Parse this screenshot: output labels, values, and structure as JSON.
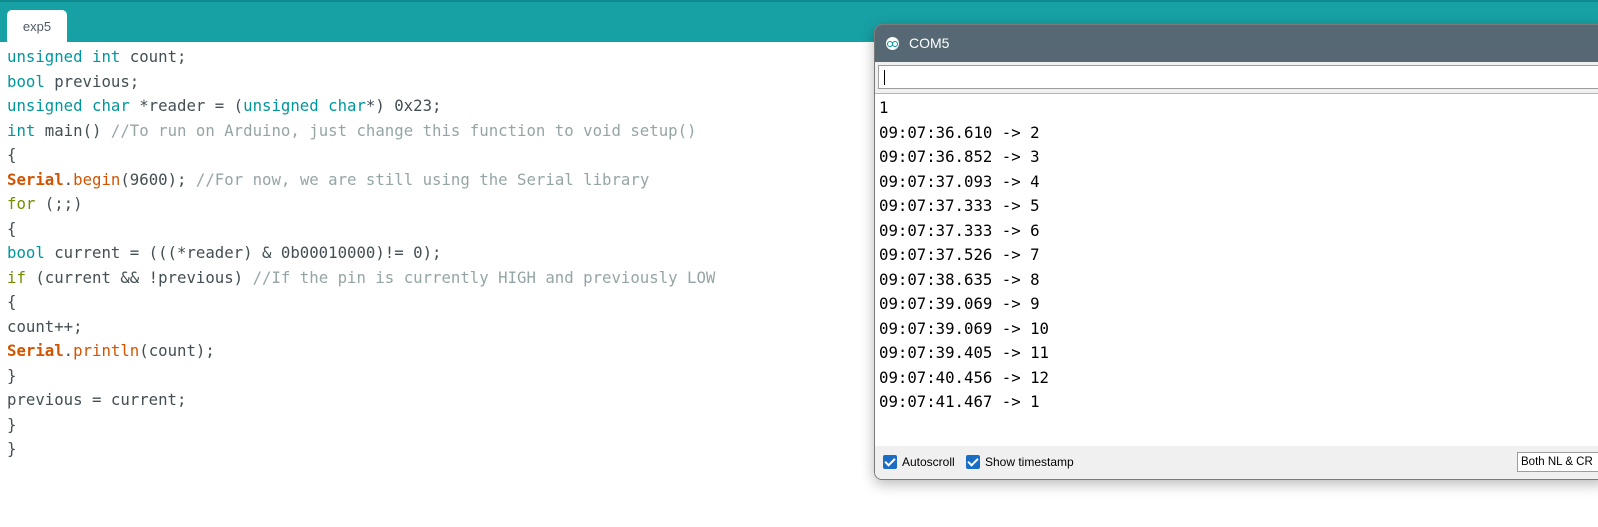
{
  "editor": {
    "tab_label": "exp5",
    "code": {
      "l1a": "unsigned int",
      "l1b": " count;",
      "l2a": "bool",
      "l2b": " previous;",
      "l3a": "unsigned char",
      "l3b": " *reader = (",
      "l3c": "unsigned char",
      "l3d": "*) 0x23;",
      "l4a": "int",
      "l4b": " main() ",
      "l4c": "//To run on Arduino, just change this function to void setup()",
      "l5": "{",
      "l6a": "Serial",
      "l6b": ".",
      "l6c": "begin",
      "l6d": "(9600); ",
      "l6e": "//For now, we are still using the Serial library",
      "l7a": "for",
      "l7b": " (;;)",
      "l8": "{",
      "l9a": "bool",
      "l9b": " current = (((*reader) & 0b00010000)!= 0);",
      "l10a": "if",
      "l10b": " (current && !previous) ",
      "l10c": "//If the pin is currently HIGH and previously LOW",
      "l11": "{",
      "l12": "count++;",
      "l13a": "Serial",
      "l13b": ".",
      "l13c": "println",
      "l13d": "(count);",
      "l14": "}",
      "l15": "previous = current;",
      "l16": "}",
      "l17": "}"
    }
  },
  "serial_monitor": {
    "title": "COM5",
    "input_value": "",
    "output": [
      "1",
      "09:07:36.610 -> 2",
      "09:07:36.852 -> 3",
      "09:07:37.093 -> 4",
      "09:07:37.333 -> 5",
      "09:07:37.333 -> 6",
      "09:07:37.526 -> 7",
      "09:07:38.635 -> 8",
      "09:07:39.069 -> 9",
      "09:07:39.069 -> 10",
      "09:07:39.405 -> 11",
      "09:07:40.456 -> 12",
      "09:07:41.467 -> 1"
    ],
    "autoscroll_label": "Autoscroll",
    "autoscroll_checked": true,
    "timestamp_label": "Show timestamp",
    "timestamp_checked": true,
    "line_ending": "Both NL & CR"
  },
  "colors": {
    "tabbar": "#17a1a5",
    "keyword": "#00979c",
    "control": "#728e00",
    "serial_class": "#d35400",
    "comment": "#95a5a6",
    "titlebar": "#556873",
    "checkbox": "#1a6cc5"
  },
  "icons": [
    "arduino-icon",
    "checkbox-checked-icon"
  ]
}
